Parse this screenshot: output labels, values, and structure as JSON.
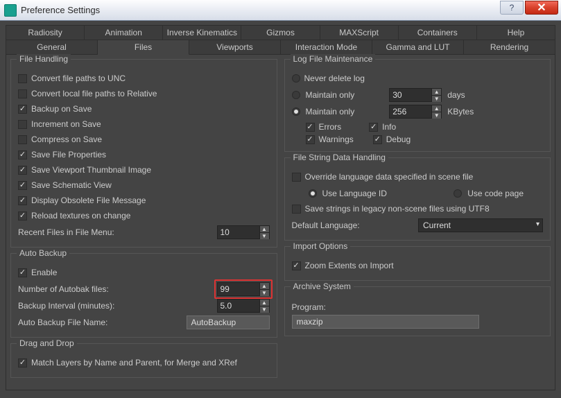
{
  "window": {
    "title": "Preference Settings"
  },
  "tabs_row1": [
    "Radiosity",
    "Animation",
    "Inverse Kinematics",
    "Gizmos",
    "MAXScript",
    "Containers",
    "Help"
  ],
  "tabs_row2": [
    "General",
    "Files",
    "Viewports",
    "Interaction Mode",
    "Gamma and LUT",
    "Rendering"
  ],
  "active_tab": "Files",
  "file_handling": {
    "legend": "File Handling",
    "convert_unc": "Convert file paths to UNC",
    "convert_relative": "Convert local file paths to Relative",
    "backup_on_save": "Backup on Save",
    "increment_on_save": "Increment on Save",
    "compress_on_save": "Compress on Save",
    "save_file_props": "Save File Properties",
    "save_thumb": "Save Viewport Thumbnail Image",
    "save_schem": "Save Schematic View",
    "display_obsolete": "Display Obsolete File Message",
    "reload_textures": "Reload textures on change",
    "recent_label": "Recent Files in File Menu:",
    "recent_value": "10"
  },
  "auto_backup": {
    "legend": "Auto Backup",
    "enable": "Enable",
    "autobak_label": "Number of Autobak files:",
    "autobak_value": "99",
    "interval_label": "Backup Interval (minutes):",
    "interval_value": "5.0",
    "filename_label": "Auto Backup File Name:",
    "filename_value": "AutoBackup"
  },
  "drag_drop": {
    "legend": "Drag and Drop",
    "match_layers": "Match Layers by Name and Parent, for Merge and XRef"
  },
  "log_maint": {
    "legend": "Log File Maintenance",
    "never_delete": "Never delete log",
    "maintain_days": "Maintain only",
    "days_value": "30",
    "days_unit": "days",
    "maintain_kb": "Maintain only",
    "kb_value": "256",
    "kb_unit": "KBytes",
    "errors": "Errors",
    "info": "Info",
    "warnings": "Warnings",
    "debug": "Debug"
  },
  "string_handling": {
    "legend": "File String Data Handling",
    "override": "Override language data specified in scene file",
    "use_lang_id": "Use Language ID",
    "use_code_page": "Use code page",
    "save_utf8": "Save strings in legacy non-scene files using UTF8",
    "default_lang_label": "Default Language:",
    "default_lang_value": "Current"
  },
  "import_opts": {
    "legend": "Import Options",
    "zoom_extents": "Zoom Extents on Import"
  },
  "archive": {
    "legend": "Archive System",
    "program_label": "Program:",
    "program_value": "maxzip"
  }
}
